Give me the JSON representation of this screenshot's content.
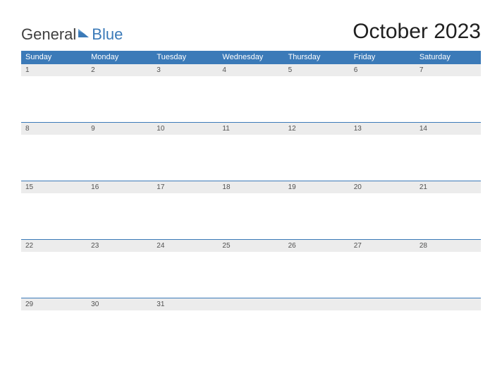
{
  "logo": {
    "general": "General",
    "blue": "Blue"
  },
  "title": "October 2023",
  "dayHeaders": [
    "Sunday",
    "Monday",
    "Tuesday",
    "Wednesday",
    "Thursday",
    "Friday",
    "Saturday"
  ],
  "weeks": [
    [
      "1",
      "2",
      "3",
      "4",
      "5",
      "6",
      "7"
    ],
    [
      "8",
      "9",
      "10",
      "11",
      "12",
      "13",
      "14"
    ],
    [
      "15",
      "16",
      "17",
      "18",
      "19",
      "20",
      "21"
    ],
    [
      "22",
      "23",
      "24",
      "25",
      "26",
      "27",
      "28"
    ],
    [
      "29",
      "30",
      "31",
      "",
      "",
      "",
      ""
    ]
  ]
}
